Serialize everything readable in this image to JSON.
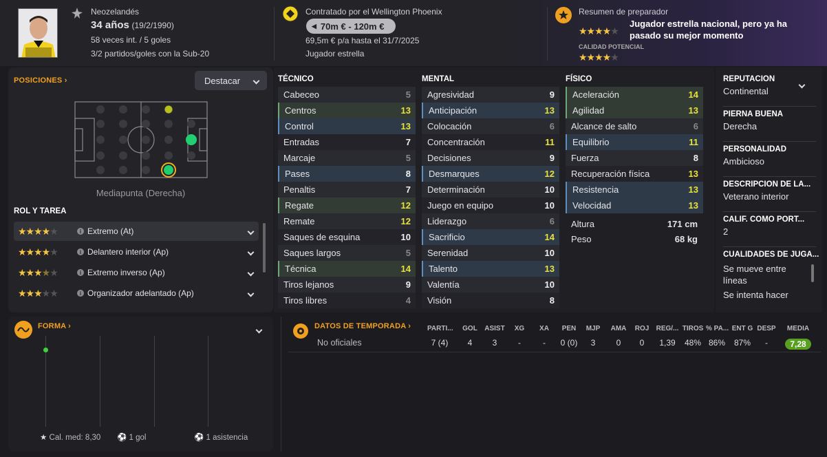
{
  "header": {
    "nationality": "Neozelandés",
    "age": "34 años",
    "dob": "(19/2/1990)",
    "caps": "58 veces int. / 5 goles",
    "youth": "3/2 partidos/goles con la Sub-20",
    "contract_title": "Contratado por el Wellington Phoenix",
    "value": "70m € - 120m €",
    "wage": "69,5m € p/a hasta el 31/7/2025",
    "status": "Jugador estrella",
    "coach_title": "Resumen de preparador",
    "coach_text": "Jugador estrella nacional, pero ya ha pasado su mejor momento",
    "current_stars": 4,
    "potential_label": "CALIDAD POTENCIAL",
    "potential_stars": 4
  },
  "positions": {
    "title": "POSICIONES",
    "dropdown": "Destacar",
    "position_label": "Mediapunta (Derecha)"
  },
  "roles": {
    "title": "ROL Y TAREA",
    "items": [
      {
        "label": "Extremo (At)",
        "stars": 4,
        "selected": true
      },
      {
        "label": "Delantero interior (Ap)",
        "stars": 4,
        "selected": false
      },
      {
        "label": "Extremo inverso (Ap)",
        "stars": 3.5,
        "selected": false
      },
      {
        "label": "Organizador adelantado (Ap)",
        "stars": 3,
        "selected": false
      }
    ]
  },
  "technical": {
    "title": "TÉCNICO",
    "rows": [
      {
        "n": "Cabeceo",
        "v": "5",
        "h": ""
      },
      {
        "n": "Centros",
        "v": "13",
        "h": "g"
      },
      {
        "n": "Control",
        "v": "13",
        "h": "b"
      },
      {
        "n": "Entradas",
        "v": "7",
        "h": ""
      },
      {
        "n": "Marcaje",
        "v": "5",
        "h": ""
      },
      {
        "n": "Pases",
        "v": "8",
        "h": "b"
      },
      {
        "n": "Penaltis",
        "v": "7",
        "h": ""
      },
      {
        "n": "Regate",
        "v": "12",
        "h": "g"
      },
      {
        "n": "Remate",
        "v": "12",
        "h": ""
      },
      {
        "n": "Saques de esquina",
        "v": "10",
        "h": ""
      },
      {
        "n": "Saques largos",
        "v": "5",
        "h": ""
      },
      {
        "n": "Técnica",
        "v": "14",
        "h": "g"
      },
      {
        "n": "Tiros lejanos",
        "v": "9",
        "h": ""
      },
      {
        "n": "Tiros libres",
        "v": "4",
        "h": ""
      }
    ]
  },
  "mental": {
    "title": "MENTAL",
    "rows": [
      {
        "n": "Agresividad",
        "v": "9",
        "h": ""
      },
      {
        "n": "Anticipación",
        "v": "13",
        "h": "b"
      },
      {
        "n": "Colocación",
        "v": "6",
        "h": ""
      },
      {
        "n": "Concentración",
        "v": "11",
        "h": ""
      },
      {
        "n": "Decisiones",
        "v": "9",
        "h": ""
      },
      {
        "n": "Desmarques",
        "v": "12",
        "h": "b"
      },
      {
        "n": "Determinación",
        "v": "10",
        "h": ""
      },
      {
        "n": "Juego en equipo",
        "v": "10",
        "h": ""
      },
      {
        "n": "Liderazgo",
        "v": "6",
        "h": ""
      },
      {
        "n": "Sacrificio",
        "v": "14",
        "h": "b"
      },
      {
        "n": "Serenidad",
        "v": "10",
        "h": ""
      },
      {
        "n": "Talento",
        "v": "13",
        "h": "b"
      },
      {
        "n": "Valentía",
        "v": "10",
        "h": ""
      },
      {
        "n": "Visión",
        "v": "8",
        "h": ""
      }
    ]
  },
  "physical": {
    "title": "FÍSICO",
    "rows": [
      {
        "n": "Aceleración",
        "v": "14",
        "h": "g"
      },
      {
        "n": "Agilidad",
        "v": "13",
        "h": "g"
      },
      {
        "n": "Alcance de salto",
        "v": "6",
        "h": ""
      },
      {
        "n": "Equilibrio",
        "v": "11",
        "h": "b"
      },
      {
        "n": "Fuerza",
        "v": "8",
        "h": ""
      },
      {
        "n": "Recuperación física",
        "v": "13",
        "h": ""
      },
      {
        "n": "Resistencia",
        "v": "13",
        "h": "b"
      },
      {
        "n": "Velocidad",
        "v": "13",
        "h": "b"
      }
    ],
    "height_label": "Altura",
    "height": "171 cm",
    "weight_label": "Peso",
    "weight": "68 kg"
  },
  "info": [
    {
      "label": "REPUTACIÓN",
      "value": "Continental"
    },
    {
      "label": "PIERNA BUENA",
      "value": "Derecha"
    },
    {
      "label": "PERSONALIDAD",
      "value": "Ambicioso"
    },
    {
      "label": "DESCRIPCIÓN DE LA...",
      "value": "Veterano interior"
    },
    {
      "label": "CALIF. COMO PORT...",
      "value": "2"
    },
    {
      "label": "CUALIDADES DE JUGA...",
      "value": "Se mueve entre líneas",
      "value2": "Se intenta hacer"
    }
  ],
  "form": {
    "title": "FORMA",
    "avg": "Cal. med: 8,30",
    "goals": "1 gol",
    "assists": "1 asistencia"
  },
  "season": {
    "title": "DATOS DE TEMPORADA",
    "headers": [
      "PARTI...",
      "GOL",
      "ASIST",
      "XG",
      "XA",
      "PEN",
      "MJP",
      "AMA",
      "ROJ",
      "REG/...",
      "TIROS",
      "% PA...",
      "ENT G",
      "DESP",
      "MEDIA"
    ],
    "row_label": "No oficiales",
    "values": [
      "7 (4)",
      "4",
      "3",
      "-",
      "-",
      "0 (0)",
      "3",
      "0",
      "0",
      "1,39",
      "48%",
      "86%",
      "87%",
      "-",
      "7,28"
    ]
  },
  "colors": {
    "accent": "#f0a020",
    "green_highlight": "#6fa87a",
    "blue_highlight": "#5f8fbf",
    "yellow_value": "#e8e23a",
    "media_badge": "#5aa020"
  }
}
